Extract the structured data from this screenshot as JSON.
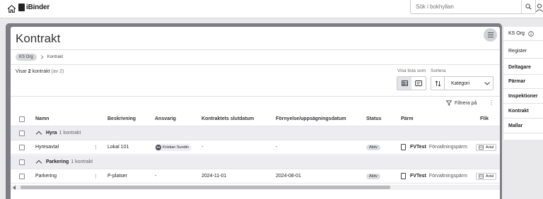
{
  "topbar": {
    "logo_text": "iBinder",
    "search_placeholder": "Sök i bokhyllan"
  },
  "page": {
    "title": "Kontrakt",
    "breadcrumb": [
      "KS Org",
      "Kontrakt"
    ],
    "showing_prefix": "Visar",
    "showing_count": "2",
    "showing_word": "kontrakt",
    "showing_total": "(av 2)",
    "view_list_label": "Visa lista som",
    "sort_label": "Sortera",
    "sort_value": "Kategori",
    "filter_label": "Filtrera på"
  },
  "table": {
    "columns": [
      "Namn",
      "Beskrivning",
      "Ansvarig",
      "Kontraktets slutdatum",
      "Förnyelse/uppsägningsdatum",
      "Status",
      "Pärm",
      "Flik"
    ],
    "groups": [
      {
        "name": "Hyra",
        "count": "1 kontrakt",
        "rows": [
          {
            "name": "Hyresavtal",
            "description": "Lokal 101",
            "responsible": "Kristian Sundin",
            "responsible_initials": "KS",
            "end_date": "-",
            "renewal_date": "-",
            "status": "Aktiv",
            "binder_code": "FVTest",
            "binder_name": "Förvaltningspärm",
            "tab": "Avtal"
          }
        ]
      },
      {
        "name": "Parkering",
        "count": "1 kontrakt",
        "rows": [
          {
            "name": "Parkering",
            "description": "P-platser",
            "responsible": "-",
            "end_date": "2024-11-01",
            "renewal_date": "2024-08-01",
            "status": "Aktiv",
            "binder_code": "FVTest",
            "binder_name": "Förvaltningspärm",
            "tab": "Avtal"
          }
        ]
      }
    ]
  },
  "sidebar": {
    "org_label": "KS Org",
    "items": [
      "Register",
      "Deltagare",
      "Pärmar",
      "Inspektioner",
      "Kontrakt",
      "Mallar"
    ]
  },
  "colors": {
    "background": "#e9e9ec",
    "panel_frame": "#7d7d85",
    "group_row": "#ececf1"
  }
}
